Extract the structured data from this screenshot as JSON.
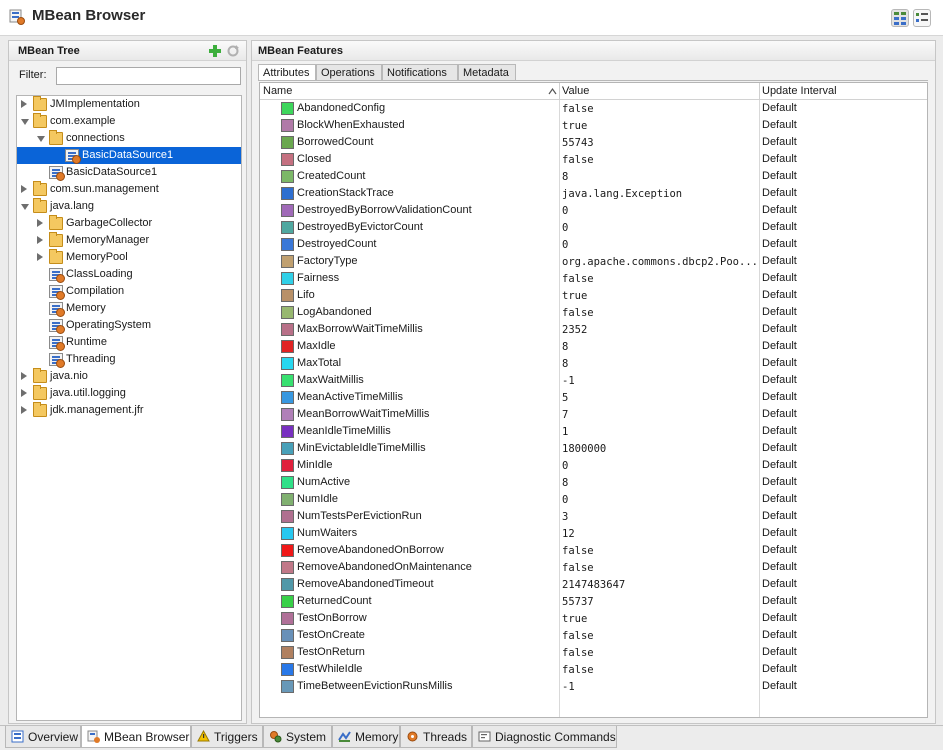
{
  "window": {
    "title": "MBean Browser"
  },
  "left_panel": {
    "title": "MBean Tree",
    "filter_label": "Filter:",
    "filter_value": "",
    "tree": [
      {
        "label": "JMImplementation",
        "level": 0,
        "type": "folder",
        "expanded": false,
        "selected": false
      },
      {
        "label": "com.example",
        "level": 0,
        "type": "folder",
        "expanded": true,
        "selected": false
      },
      {
        "label": "connections",
        "level": 1,
        "type": "folder",
        "expanded": true,
        "selected": false
      },
      {
        "label": "BasicDataSource1",
        "level": 2,
        "type": "bean",
        "selected": true
      },
      {
        "label": "BasicDataSource1",
        "level": 1,
        "type": "bean",
        "selected": false
      },
      {
        "label": "com.sun.management",
        "level": 0,
        "type": "folder",
        "expanded": false,
        "selected": false
      },
      {
        "label": "java.lang",
        "level": 0,
        "type": "folder",
        "expanded": true,
        "selected": false
      },
      {
        "label": "GarbageCollector",
        "level": 1,
        "type": "folder",
        "expanded": false,
        "selected": false
      },
      {
        "label": "MemoryManager",
        "level": 1,
        "type": "folder",
        "expanded": false,
        "selected": false
      },
      {
        "label": "MemoryPool",
        "level": 1,
        "type": "folder",
        "expanded": false,
        "selected": false
      },
      {
        "label": "ClassLoading",
        "level": 1,
        "type": "bean",
        "selected": false
      },
      {
        "label": "Compilation",
        "level": 1,
        "type": "bean",
        "selected": false
      },
      {
        "label": "Memory",
        "level": 1,
        "type": "bean",
        "selected": false
      },
      {
        "label": "OperatingSystem",
        "level": 1,
        "type": "bean",
        "selected": false
      },
      {
        "label": "Runtime",
        "level": 1,
        "type": "bean",
        "selected": false
      },
      {
        "label": "Threading",
        "level": 1,
        "type": "bean",
        "selected": false
      },
      {
        "label": "java.nio",
        "level": 0,
        "type": "folder",
        "expanded": false,
        "selected": false
      },
      {
        "label": "java.util.logging",
        "level": 0,
        "type": "folder",
        "expanded": false,
        "selected": false
      },
      {
        "label": "jdk.management.jfr",
        "level": 0,
        "type": "folder",
        "expanded": false,
        "selected": false
      }
    ]
  },
  "right_panel": {
    "title": "MBean Features",
    "tabs": [
      {
        "label": "Attributes",
        "active": true
      },
      {
        "label": "Operations",
        "active": false
      },
      {
        "label": "Notifications",
        "active": false
      },
      {
        "label": "Metadata",
        "active": false
      }
    ],
    "columns": {
      "name": "Name",
      "value": "Value",
      "interval": "Update Interval"
    },
    "rows": [
      {
        "name": "AbandonedConfig",
        "value": "false",
        "interval": "Default",
        "color": "#3dd65c"
      },
      {
        "name": "BlockWhenExhausted",
        "value": "true",
        "interval": "Default",
        "color": "#b07aa8"
      },
      {
        "name": "BorrowedCount",
        "value": "55743",
        "interval": "Default",
        "color": "#6aa84f"
      },
      {
        "name": "Closed",
        "value": "false",
        "interval": "Default",
        "color": "#c47080"
      },
      {
        "name": "CreatedCount",
        "value": "8",
        "interval": "Default",
        "color": "#7cb868"
      },
      {
        "name": "CreationStackTrace",
        "value": "java.lang.Exception",
        "interval": "Default",
        "color": "#2e6fd0"
      },
      {
        "name": "DestroyedByBorrowValidationCount",
        "value": "0",
        "interval": "Default",
        "color": "#a06ab8"
      },
      {
        "name": "DestroyedByEvictorCount",
        "value": "0",
        "interval": "Default",
        "color": "#4fa8a0"
      },
      {
        "name": "DestroyedCount",
        "value": "0",
        "interval": "Default",
        "color": "#3a78d8"
      },
      {
        "name": "FactoryType",
        "value": "org.apache.commons.dbcp2.Poo...",
        "interval": "Default",
        "color": "#c0a070"
      },
      {
        "name": "Fairness",
        "value": "false",
        "interval": "Default",
        "color": "#30d0e8"
      },
      {
        "name": "Lifo",
        "value": "true",
        "interval": "Default",
        "color": "#b89068"
      },
      {
        "name": "LogAbandoned",
        "value": "false",
        "interval": "Default",
        "color": "#98b870"
      },
      {
        "name": "MaxBorrowWaitTimeMillis",
        "value": "2352",
        "interval": "Default",
        "color": "#b87088"
      },
      {
        "name": "MaxIdle",
        "value": "8",
        "interval": "Default",
        "color": "#e02424"
      },
      {
        "name": "MaxTotal",
        "value": "8",
        "interval": "Default",
        "color": "#28d8f0"
      },
      {
        "name": "MaxWaitMillis",
        "value": "-1",
        "interval": "Default",
        "color": "#38e070"
      },
      {
        "name": "MeanActiveTimeMillis",
        "value": "5",
        "interval": "Default",
        "color": "#3898e0"
      },
      {
        "name": "MeanBorrowWaitTimeMillis",
        "value": "7",
        "interval": "Default",
        "color": "#b080b8"
      },
      {
        "name": "MeanIdleTimeMillis",
        "value": "1",
        "interval": "Default",
        "color": "#7830c0"
      },
      {
        "name": "MinEvictableIdleTimeMillis",
        "value": "1800000",
        "interval": "Default",
        "color": "#48a0b8"
      },
      {
        "name": "MinIdle",
        "value": "0",
        "interval": "Default",
        "color": "#e0203c"
      },
      {
        "name": "NumActive",
        "value": "8",
        "interval": "Default",
        "color": "#30e088"
      },
      {
        "name": "NumIdle",
        "value": "0",
        "interval": "Default",
        "color": "#80b070"
      },
      {
        "name": "NumTestsPerEvictionRun",
        "value": "3",
        "interval": "Default",
        "color": "#b07090"
      },
      {
        "name": "NumWaiters",
        "value": "12",
        "interval": "Default",
        "color": "#28c8f0"
      },
      {
        "name": "RemoveAbandonedOnBorrow",
        "value": "false",
        "interval": "Default",
        "color": "#f01818"
      },
      {
        "name": "RemoveAbandonedOnMaintenance",
        "value": "false",
        "interval": "Default",
        "color": "#c07888"
      },
      {
        "name": "RemoveAbandonedTimeout",
        "value": "2147483647",
        "interval": "Default",
        "color": "#5098a8"
      },
      {
        "name": "ReturnedCount",
        "value": "55737",
        "interval": "Default",
        "color": "#38d048"
      },
      {
        "name": "TestOnBorrow",
        "value": "true",
        "interval": "Default",
        "color": "#b07098"
      },
      {
        "name": "TestOnCreate",
        "value": "false",
        "interval": "Default",
        "color": "#6890b8"
      },
      {
        "name": "TestOnReturn",
        "value": "false",
        "interval": "Default",
        "color": "#b08060"
      },
      {
        "name": "TestWhileIdle",
        "value": "false",
        "interval": "Default",
        "color": "#2878e8"
      },
      {
        "name": "TimeBetweenEvictionRunsMillis",
        "value": "-1",
        "interval": "Default",
        "color": "#6898b8"
      }
    ]
  },
  "bottom_tabs": [
    {
      "label": "Overview",
      "icon": "overview-icon",
      "active": false
    },
    {
      "label": "MBean Browser",
      "icon": "mbean-browser-icon",
      "active": true
    },
    {
      "label": "Triggers",
      "icon": "triggers-icon",
      "active": false
    },
    {
      "label": "System",
      "icon": "system-icon",
      "active": false
    },
    {
      "label": "Memory",
      "icon": "memory-icon",
      "active": false
    },
    {
      "label": "Threads",
      "icon": "threads-icon",
      "active": false
    },
    {
      "label": "Diagnostic Commands",
      "icon": "diagnostic-commands-icon",
      "active": false
    }
  ]
}
